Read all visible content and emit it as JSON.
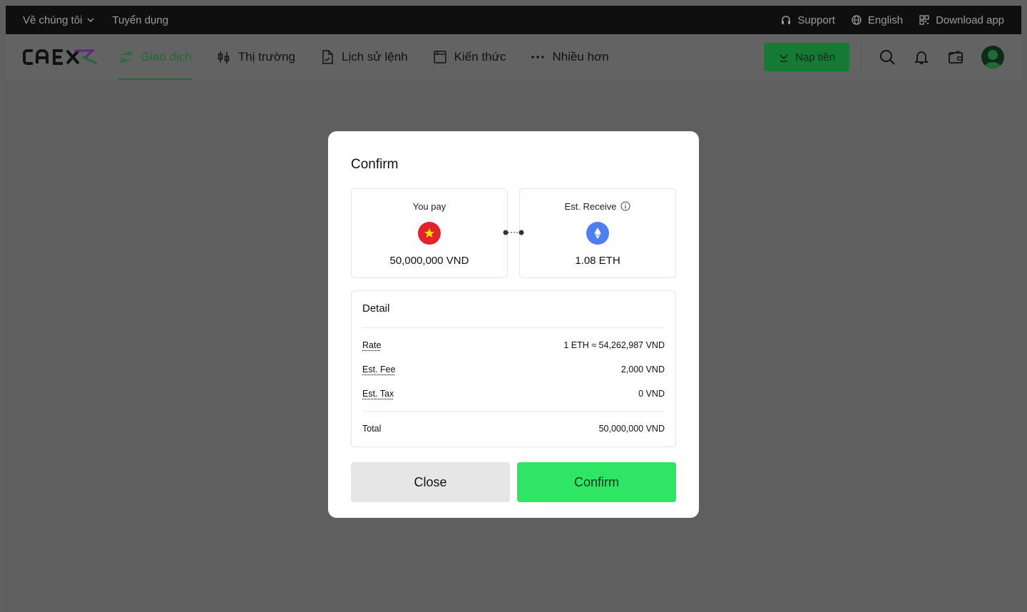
{
  "topbar": {
    "about": "Về chúng tôi",
    "careers": "Tuyển dụng",
    "support": "Support",
    "language": "English",
    "download": "Download app"
  },
  "nav": {
    "logo_text": "CAEX",
    "items": [
      {
        "label": "Giao dịch",
        "icon": "swap-icon",
        "active": true
      },
      {
        "label": "Thị trường",
        "icon": "candlestick-icon",
        "active": false
      },
      {
        "label": "Lịch sử lệnh",
        "icon": "document-icon",
        "active": false
      },
      {
        "label": "Kiến thức",
        "icon": "book-icon",
        "active": false
      },
      {
        "label": "Nhiều hơn",
        "icon": "more-icon",
        "active": false
      }
    ],
    "deposit": "Nạp tiền"
  },
  "modal": {
    "title": "Confirm",
    "pay": {
      "label": "You pay",
      "amount": "50,000,000 VND",
      "icon": "vietnam-flag-icon"
    },
    "receive": {
      "label": "Est. Receive",
      "amount": "1.08 ETH",
      "icon": "ethereum-icon"
    },
    "detail": {
      "title": "Detail",
      "rows": [
        {
          "label": "Rate",
          "value": "1 ETH ≈ 54,262,987 VND"
        },
        {
          "label": "Est. Fee",
          "value": "2,000 VND"
        },
        {
          "label": "Est. Tax",
          "value": "0 VND"
        }
      ],
      "total_label": "Total",
      "total_value": "50,000,000 VND"
    },
    "close": "Close",
    "confirm": "Confirm"
  },
  "colors": {
    "brand_green": "#2ee663",
    "nav_active": "#1f6a36",
    "overlay": "#606060"
  }
}
